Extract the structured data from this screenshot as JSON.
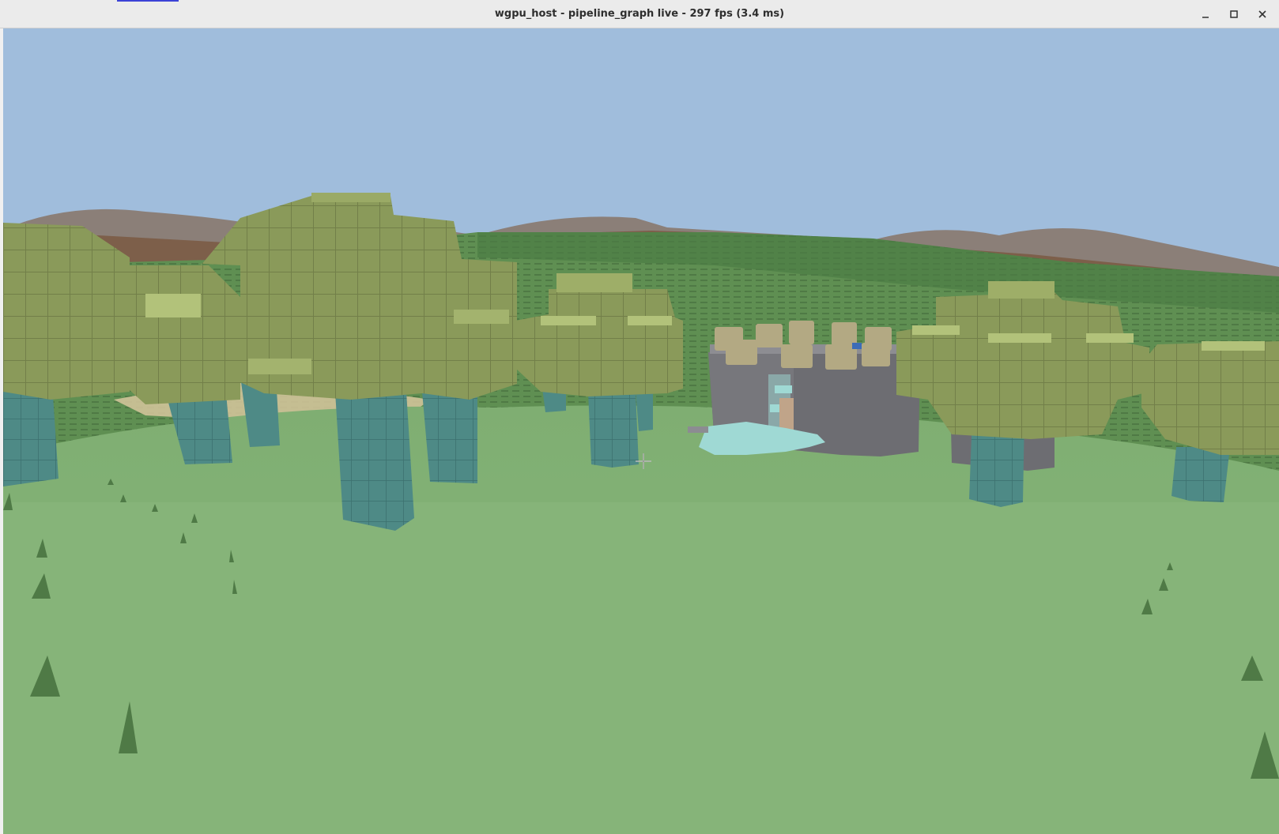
{
  "window": {
    "title": "wgpu_host - pipeline_graph live - 297 fps (3.4 ms)",
    "controls": {
      "minimize_icon": "minimize-icon",
      "maximize_icon": "maximize-icon",
      "close_icon": "close-icon"
    }
  },
  "scene": {
    "colors": {
      "sky": "#a0bddc",
      "hills_far": "#8b7f78",
      "hills_brown": "#7d5f4a",
      "terrain_mid": "#5a8a4f",
      "grass": "#86b479",
      "canopy": "#8a9a5a",
      "canopy_light": "#b2c27a",
      "trunk": "#4e8a86",
      "tower": "#6d6d72",
      "merlon": "#b3a983",
      "water": "#9fd9d4"
    },
    "cursor_icon": "crosshair-icon"
  }
}
